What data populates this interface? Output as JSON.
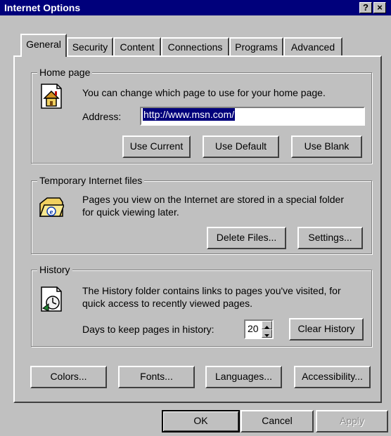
{
  "window": {
    "title": "Internet Options",
    "help_label": "?",
    "close_label": "×"
  },
  "tabs": [
    {
      "label": "General"
    },
    {
      "label": "Security"
    },
    {
      "label": "Content"
    },
    {
      "label": "Connections"
    },
    {
      "label": "Programs"
    },
    {
      "label": "Advanced"
    }
  ],
  "active_tab": "General",
  "home_page": {
    "legend": "Home page",
    "description": "You can change which page to use for your home page.",
    "address_label": "Address:",
    "address_value": "http://www.msn.com/",
    "icon": "home-page-icon",
    "buttons": {
      "use_current": "Use Current",
      "use_default": "Use Default",
      "use_blank": "Use Blank"
    }
  },
  "temp_files": {
    "legend": "Temporary Internet files",
    "description_line1": "Pages you view on the Internet are stored in a special folder",
    "description_line2": "for quick viewing later.",
    "icon": "temporary-files-folder-icon",
    "buttons": {
      "delete_files": "Delete Files...",
      "settings": "Settings..."
    }
  },
  "history": {
    "legend": "History",
    "description_line1": "The History folder contains links to pages you've visited, for",
    "description_line2": "quick access to recently viewed pages.",
    "days_label": "Days to keep pages in history:",
    "days_value": "20",
    "icon": "history-clock-icon",
    "buttons": {
      "clear_history": "Clear History"
    }
  },
  "bottom_buttons": {
    "colors": "Colors...",
    "fonts": "Fonts...",
    "languages": "Languages...",
    "accessibility": "Accessibility..."
  },
  "dialog_buttons": {
    "ok": "OK",
    "cancel": "Cancel",
    "apply": "Apply"
  },
  "colors": {
    "titlebar": "#00007b",
    "face": "#c0c0c0",
    "selection": "#00007b"
  }
}
